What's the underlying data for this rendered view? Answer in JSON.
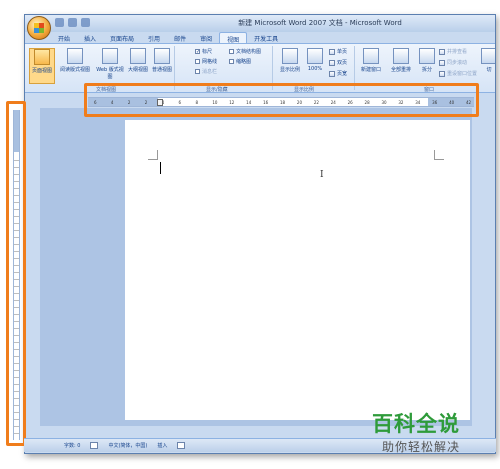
{
  "window": {
    "title": "新建 Microsoft Word 2007 文档 - Microsoft Word"
  },
  "tabs": [
    "开始",
    "插入",
    "页面布局",
    "引用",
    "邮件",
    "审阅",
    "视图",
    "开发工具"
  ],
  "active_tab": "视图",
  "ribbon": {
    "views": [
      "页面视图",
      "阅读版式视图",
      "Web 版式视图",
      "大纲视图",
      "普通视图"
    ],
    "show_hide": {
      "ruler": "标尺",
      "gridlines": "网格线",
      "message_bar": "消息栏",
      "doc_map": "文档结构图",
      "thumbnails": "缩略图"
    },
    "zoom": {
      "zoom_label": "显示比例",
      "zoom_100": "100%",
      "one_page": "单页",
      "two_pages": "双页",
      "page_width": "页宽"
    },
    "window_group": {
      "new_window": "新建窗口",
      "arrange_all": "全部重排",
      "split": "拆分",
      "side_by_side": "并排查看",
      "sync_scroll": "同步滚动",
      "reset_position": "重设窗口位置",
      "switch": "切"
    },
    "group_labels": {
      "views": "文档视图",
      "show_hide": "显示/隐藏",
      "zoom": "显示比例",
      "window": "窗口"
    }
  },
  "ruler_numbers": [
    "6",
    "4",
    "2",
    "2",
    "4",
    "6",
    "8",
    "10",
    "12",
    "14",
    "16",
    "18",
    "20",
    "22",
    "24",
    "26",
    "28",
    "30",
    "32",
    "34",
    "36",
    "40",
    "42"
  ],
  "statusbar": {
    "word_count": "字数: 0",
    "language": "中文(简体，中国)",
    "mode": "插入"
  },
  "watermark": {
    "line1": "百科全说",
    "line2": "助你轻松解决"
  },
  "colors": {
    "highlight": "#f07d1b",
    "watermark_green": "#2e9b3a"
  }
}
